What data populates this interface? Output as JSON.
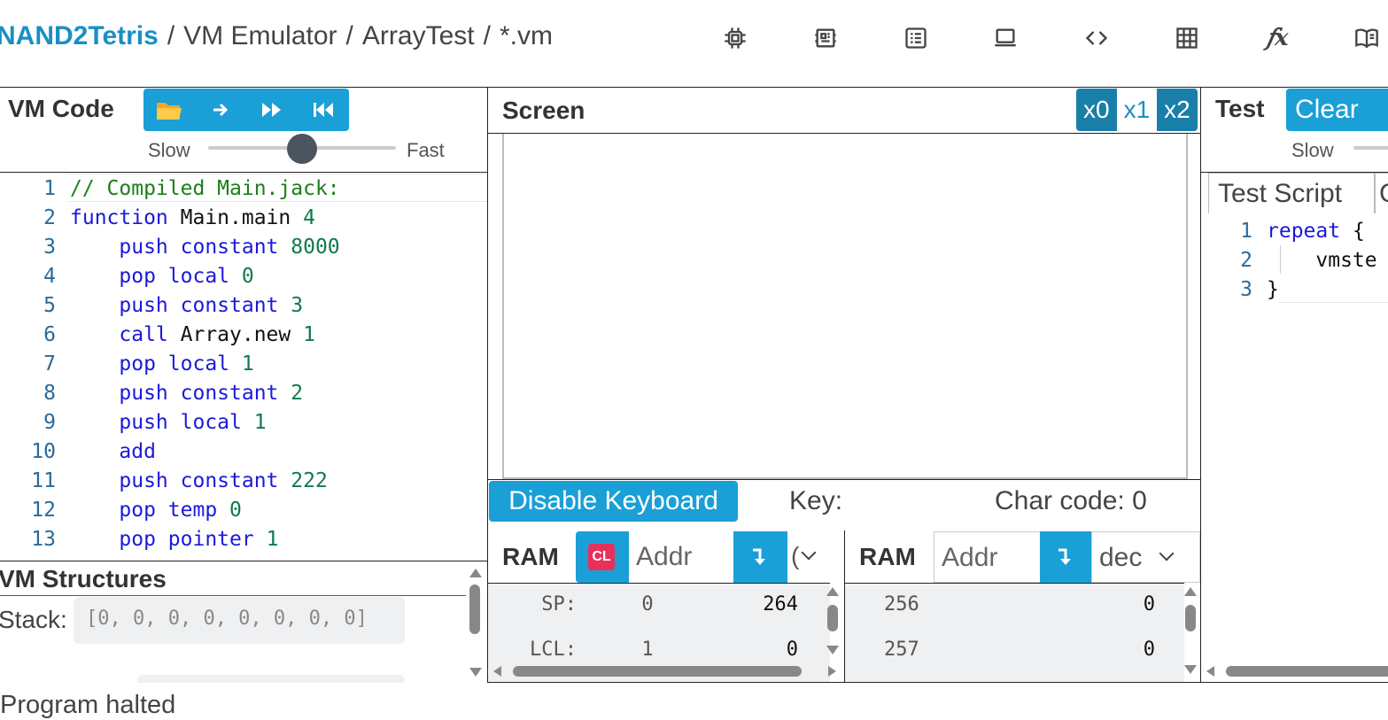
{
  "breadcrumb": {
    "brand": "NAND2Tetris",
    "section": "VM Emulator",
    "project": "ArrayTest",
    "file": "*.vm"
  },
  "nav_icons": [
    "chip-icon",
    "cpu-icon",
    "list-icon",
    "laptop-icon",
    "code-icon",
    "grid-icon",
    "function-icon",
    "book-icon"
  ],
  "vm_code": {
    "title": "VM Code",
    "speed_slow": "Slow",
    "speed_fast": "Fast",
    "speed_level": 0.5,
    "lines": [
      {
        "n": "1",
        "tokens": [
          {
            "t": "// Compiled Main.jack:",
            "c": "comment"
          }
        ]
      },
      {
        "n": "2",
        "tokens": [
          {
            "t": "function",
            "c": "kw"
          },
          {
            "t": " Main.main ",
            "c": "id"
          },
          {
            "t": "4",
            "c": "num"
          }
        ]
      },
      {
        "n": "3",
        "tokens": [
          {
            "t": "    push constant ",
            "c": "kw"
          },
          {
            "t": "8000",
            "c": "num"
          }
        ]
      },
      {
        "n": "4",
        "tokens": [
          {
            "t": "    pop local ",
            "c": "kw"
          },
          {
            "t": "0",
            "c": "num"
          }
        ]
      },
      {
        "n": "5",
        "tokens": [
          {
            "t": "    push constant ",
            "c": "kw"
          },
          {
            "t": "3",
            "c": "num"
          }
        ]
      },
      {
        "n": "6",
        "tokens": [
          {
            "t": "    call",
            "c": "kw"
          },
          {
            "t": " Array.new ",
            "c": "id"
          },
          {
            "t": "1",
            "c": "num"
          }
        ]
      },
      {
        "n": "7",
        "tokens": [
          {
            "t": "    pop local ",
            "c": "kw"
          },
          {
            "t": "1",
            "c": "num"
          }
        ]
      },
      {
        "n": "8",
        "tokens": [
          {
            "t": "    push constant ",
            "c": "kw"
          },
          {
            "t": "2",
            "c": "num"
          }
        ]
      },
      {
        "n": "9",
        "tokens": [
          {
            "t": "    push local ",
            "c": "kw"
          },
          {
            "t": "1",
            "c": "num"
          }
        ]
      },
      {
        "n": "10",
        "tokens": [
          {
            "t": "    add",
            "c": "kw"
          }
        ]
      },
      {
        "n": "11",
        "tokens": [
          {
            "t": "    push constant ",
            "c": "kw"
          },
          {
            "t": "222",
            "c": "num"
          }
        ]
      },
      {
        "n": "12",
        "tokens": [
          {
            "t": "    pop temp ",
            "c": "kw"
          },
          {
            "t": "0",
            "c": "num"
          }
        ]
      },
      {
        "n": "13",
        "tokens": [
          {
            "t": "    pop pointer ",
            "c": "kw"
          },
          {
            "t": "1",
            "c": "num"
          }
        ]
      }
    ]
  },
  "vm_structures": {
    "title": "VM Structures",
    "stack_label": "Stack:",
    "stack_value": "[0, 0, 0, 0, 0, 0, 0, 0]"
  },
  "screen": {
    "title": "Screen",
    "zoom": [
      "x0",
      "x1",
      "x2"
    ],
    "zoom_selected": "x1",
    "keyboard_button": "Disable Keyboard",
    "key_label": "Key:",
    "char_code_label": "Char code: 0"
  },
  "ram1": {
    "title": "RAM",
    "clear_badge": "CL",
    "addr_placeholder": "Addr",
    "format_value": "(",
    "rows": [
      {
        "label": "SP:",
        "addr": "0",
        "value": "264"
      },
      {
        "label": "LCL:",
        "addr": "1",
        "value": "0"
      }
    ]
  },
  "ram2": {
    "title": "RAM",
    "addr_placeholder": "Addr",
    "format_value": "dec",
    "rows": [
      {
        "addr": "256",
        "value": "0"
      },
      {
        "addr": "257",
        "value": "0"
      }
    ]
  },
  "test": {
    "title": "Test",
    "clear_button": "Clear",
    "speed_slow": "Slow",
    "tab_label": "Test Script",
    "tab2_label": "C",
    "lines": [
      {
        "n": "1",
        "tokens": [
          {
            "t": "repeat",
            "c": "kw"
          },
          {
            "t": " {",
            "c": "id"
          }
        ]
      },
      {
        "n": "2",
        "tokens": [
          {
            "t": "    vmste",
            "c": "id"
          }
        ]
      },
      {
        "n": "3",
        "tokens": [
          {
            "t": "}",
            "c": "id"
          }
        ]
      }
    ]
  },
  "status_text": "Program halted",
  "colors": {
    "accent": "#1a9fd6",
    "brand": "#1a8fc4",
    "clear_badge": "#e8305a"
  }
}
